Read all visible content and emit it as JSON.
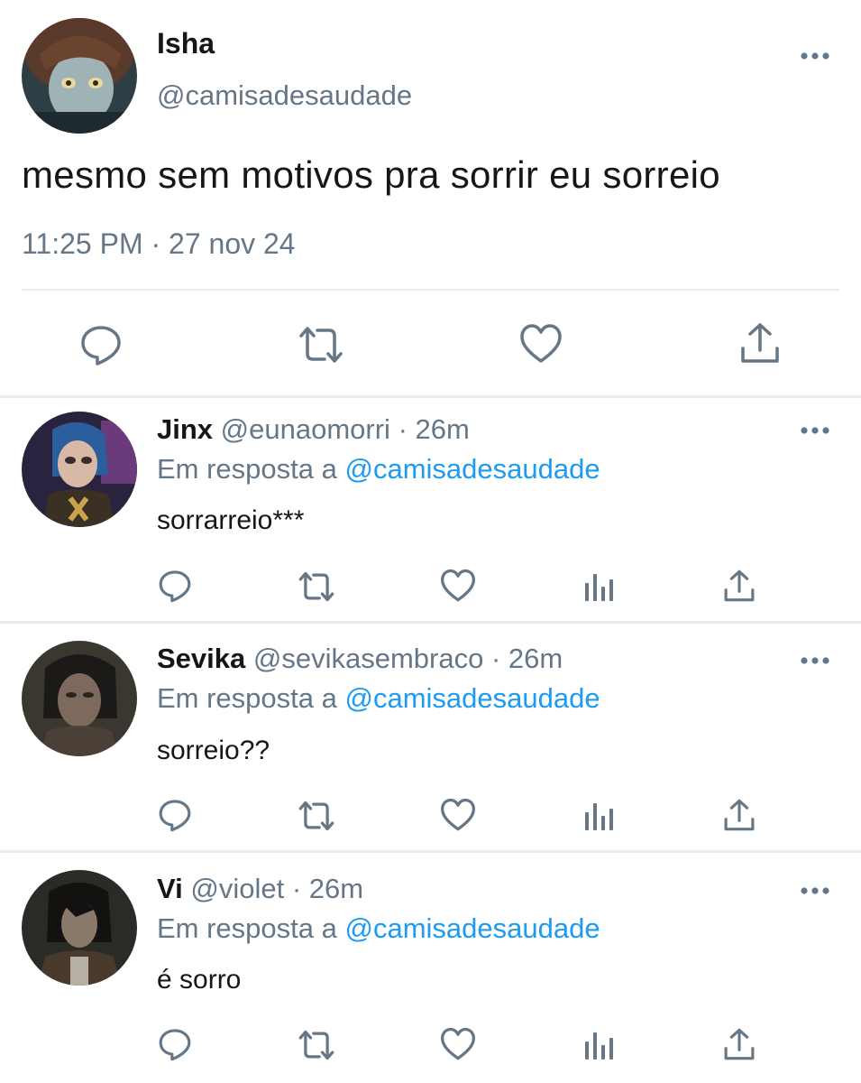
{
  "main_tweet": {
    "display_name": "Isha",
    "handle": "@camisadesaudade",
    "text": "mesmo sem motivos pra sorrir eu sorreio",
    "timestamp": "11:25 PM · 27 nov 24"
  },
  "replies": [
    {
      "display_name": "Jinx",
      "handle": "@eunaomorri",
      "time": "· 26m",
      "reply_prefix": "Em resposta a",
      "reply_to": "@camisadesaudade",
      "text": "sorrarreio***"
    },
    {
      "display_name": "Sevika",
      "handle": "@sevikasembraco",
      "time": "· 26m",
      "reply_prefix": "Em resposta a",
      "reply_to": "@camisadesaudade",
      "text": "sorreio??"
    },
    {
      "display_name": "Vi",
      "handle": "@violet",
      "time": "· 26m",
      "reply_prefix": "Em resposta a",
      "reply_to": "@camisadesaudade",
      "text": "é sorro"
    }
  ],
  "icons": {
    "reply": "comment-icon",
    "retweet": "retweet-icon",
    "like": "heart-icon",
    "views": "analytics-icon",
    "share": "share-icon",
    "more": "more-icon"
  },
  "colors": {
    "text": "#14171a",
    "secondary": "#657786",
    "link": "#1d9bf0",
    "divider": "#e6ecf0"
  }
}
